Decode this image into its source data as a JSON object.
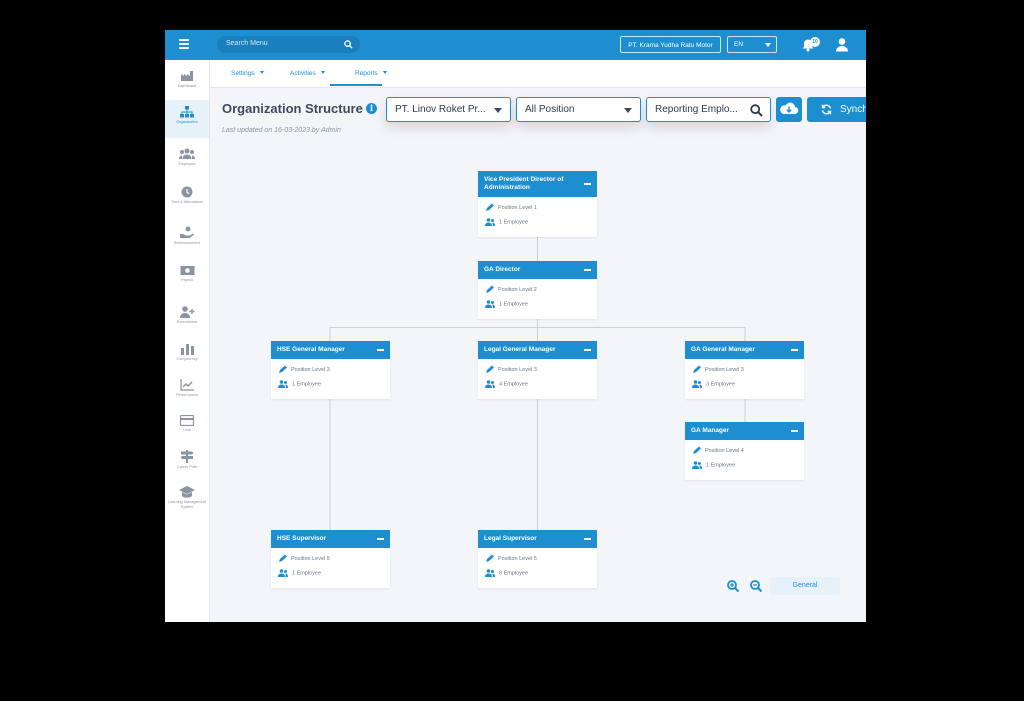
{
  "topbar": {
    "search_placeholder": "Search Menu",
    "company": "PT. Krama Yudha Ratu Motor",
    "language": "EN",
    "notification_count": "10"
  },
  "sidebar": {
    "items": [
      {
        "label": "Dashboard",
        "icon": "factory-icon"
      },
      {
        "label": "Organization",
        "icon": "org-tree-icon",
        "active": true
      },
      {
        "label": "Employee",
        "icon": "users-icon"
      },
      {
        "label": "Time & Attendance",
        "icon": "clock-icon"
      },
      {
        "label": "Reimbursement",
        "icon": "hand-money-icon"
      },
      {
        "label": "Payroll",
        "icon": "cash-icon"
      },
      {
        "label": "Recruitment",
        "icon": "user-plus-icon"
      },
      {
        "label": "Competency",
        "icon": "bar-chart-icon"
      },
      {
        "label": "Performance",
        "icon": "line-chart-icon"
      },
      {
        "label": "Loan",
        "icon": "card-icon"
      },
      {
        "label": "Career Path",
        "icon": "signpost-icon"
      },
      {
        "label": "Learning Management System",
        "icon": "graduation-cap-icon"
      }
    ]
  },
  "subnav": {
    "tabs": [
      {
        "label": "Settings"
      },
      {
        "label": "Activities",
        "active": true
      },
      {
        "label": "Reports"
      }
    ]
  },
  "page": {
    "title": "Organization Structure",
    "info": "i",
    "updated_prefix": "Last updated on ",
    "updated_date": "16-03-2023",
    "updated_mid": " by ",
    "updated_by": "Admin"
  },
  "filters": {
    "company": "PT. Linov Roket Pr...",
    "position": "All Position",
    "reporting": "Reporting Emplo..."
  },
  "actions": {
    "sync_label": "Synchronization"
  },
  "org_nodes": [
    {
      "id": "vp",
      "title": "Vice President Director of Administration",
      "level": "Position Level 1",
      "employees": "1 Employee"
    },
    {
      "id": "ga-director",
      "title": "GA Director",
      "level": "Position Level 2",
      "employees": "1 Employee"
    },
    {
      "id": "hse-gm",
      "title": "HSE General Manager",
      "level": "Position Level 3",
      "employees": "1 Employee"
    },
    {
      "id": "legal-gm",
      "title": "Legal General Manager",
      "level": "Position Level 3",
      "employees": "4 Employee"
    },
    {
      "id": "ga-gm",
      "title": "GA General Manager",
      "level": "Position Level 3",
      "employees": "3 Employee"
    },
    {
      "id": "ga-manager",
      "title": "GA Manager",
      "level": "Position Level 4",
      "employees": "1 Employee"
    },
    {
      "id": "hse-supervisor",
      "title": "HSE Supervisor",
      "level": "Position Level 5",
      "employees": "1 Employee"
    },
    {
      "id": "legal-supervisor",
      "title": "Legal Supervisor",
      "level": "Position Level 5",
      "employees": "8 Employee"
    }
  ],
  "footer": {
    "general_label": "General"
  },
  "colors": {
    "primary": "#1d8fd0",
    "background": "#f3f5f9",
    "text_dark": "#3d4a5c"
  }
}
